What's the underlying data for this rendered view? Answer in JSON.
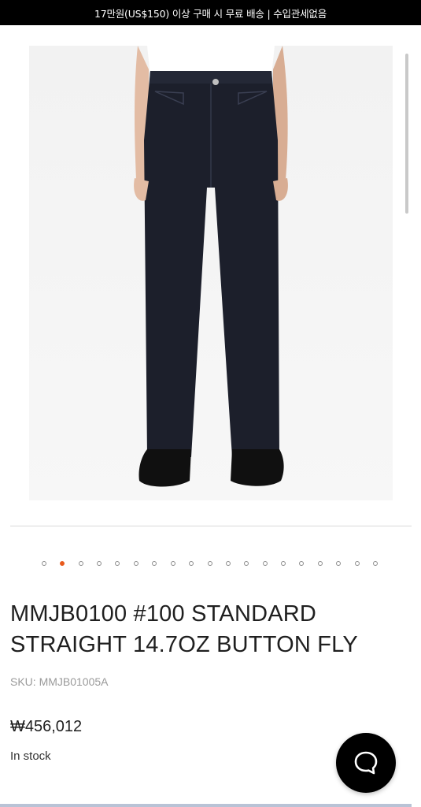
{
  "announcement": "17만원(US$150) 이상 구매 시 무료 배송 | 수입관세없음",
  "product": {
    "title": "MMJB0100 #100 STANDARD STRAIGHT 14.7OZ BUTTON FLY",
    "sku": "SKU: MMJB01005A",
    "price": "₩456,012",
    "stock": "In stock"
  },
  "gallery": {
    "image": "product-photo-raw-denim-jeans",
    "slides_total": 19,
    "active_slide": 2
  },
  "icons": {
    "chat": "chat-bubble-icon"
  },
  "colors": {
    "accent": "#e85a1c",
    "announcement_bg": "#000000",
    "chat_bg": "#000000"
  }
}
